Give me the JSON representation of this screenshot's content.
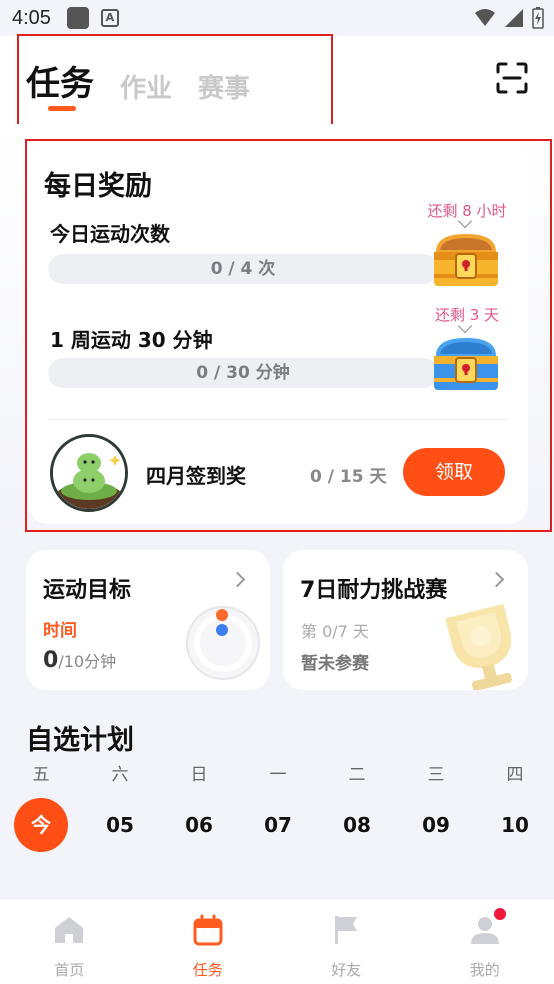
{
  "status_bar": {
    "time": "4:05"
  },
  "header": {
    "tabs": [
      {
        "label": "任务",
        "active": true
      },
      {
        "label": "作业",
        "active": false
      },
      {
        "label": "赛事",
        "active": false
      }
    ]
  },
  "daily_rewards": {
    "title": "每日奖励",
    "tasks": [
      {
        "label": "今日运动次数",
        "progress_text": "0 / 4 次",
        "remaining": "还剩 8 小时",
        "chest": "gold-chest-icon"
      },
      {
        "label": "1 周运动 30 分钟",
        "progress_text": "0 / 30 分钟",
        "remaining": "还剩 3 天",
        "chest": "blue-chest-icon"
      }
    ],
    "sign_in": {
      "label": "四月签到奖",
      "count": "0 / 15 天",
      "button": "领取"
    }
  },
  "goal_card": {
    "title": "运动目标",
    "metric": "时间",
    "value": "0",
    "target": "/10分钟"
  },
  "challenge_card": {
    "title": "7日耐力挑战赛",
    "progress": "第 0/7 天",
    "status": "暂未参赛"
  },
  "plan": {
    "title": "自选计划",
    "days": [
      {
        "weekday": "五",
        "date": "今",
        "today": true
      },
      {
        "weekday": "六",
        "date": "05",
        "today": false
      },
      {
        "weekday": "日",
        "date": "06",
        "today": false
      },
      {
        "weekday": "一",
        "date": "07",
        "today": false
      },
      {
        "weekday": "二",
        "date": "08",
        "today": false
      },
      {
        "weekday": "三",
        "date": "09",
        "today": false
      },
      {
        "weekday": "四",
        "date": "10",
        "today": false
      }
    ]
  },
  "bottom_nav": [
    {
      "label": "首页",
      "icon": "home-icon",
      "active": false
    },
    {
      "label": "任务",
      "icon": "calendar-icon",
      "active": true
    },
    {
      "label": "好友",
      "icon": "flag-icon",
      "active": false
    },
    {
      "label": "我的",
      "icon": "user-icon",
      "active": false
    }
  ],
  "colors": {
    "accent": "#ff4f14",
    "remaining_text": "#e0578a",
    "highlight_box": "#e02020"
  }
}
